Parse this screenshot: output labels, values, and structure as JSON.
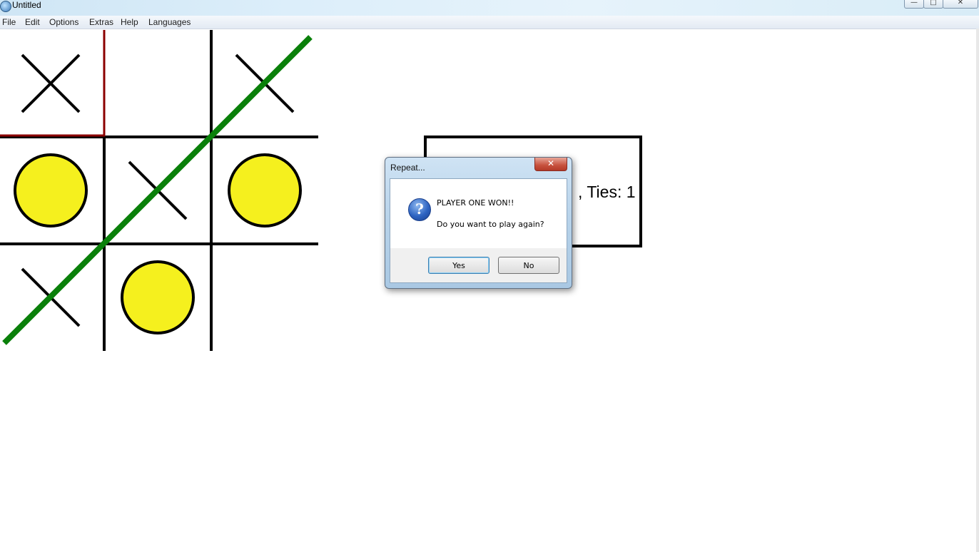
{
  "window": {
    "title": "Untitled",
    "controls": [
      "minimize",
      "maximize",
      "close"
    ]
  },
  "menu": {
    "items": [
      "File",
      "Edit",
      "Options",
      "Extras",
      "Help",
      "Languages"
    ]
  },
  "board": {
    "cells": [
      [
        "X",
        "",
        "X"
      ],
      [
        "O",
        "X",
        "O"
      ],
      [
        "X",
        "O",
        ""
      ]
    ],
    "highlighted_cell": {
      "row": 0,
      "col": 0
    },
    "win_line": "anti-diagonal",
    "colors": {
      "grid": "#000000",
      "highlight": "#8b0000",
      "o_fill": "#f5f01e",
      "win_line": "#0a800a"
    }
  },
  "score": {
    "visible_text": ", Ties: 1"
  },
  "dialog": {
    "title": "Repeat...",
    "message": "PLAYER ONE WON!!",
    "question": "Do you want to play again?",
    "icon": "question-icon",
    "buttons": {
      "yes": "Yes",
      "no": "No"
    }
  }
}
